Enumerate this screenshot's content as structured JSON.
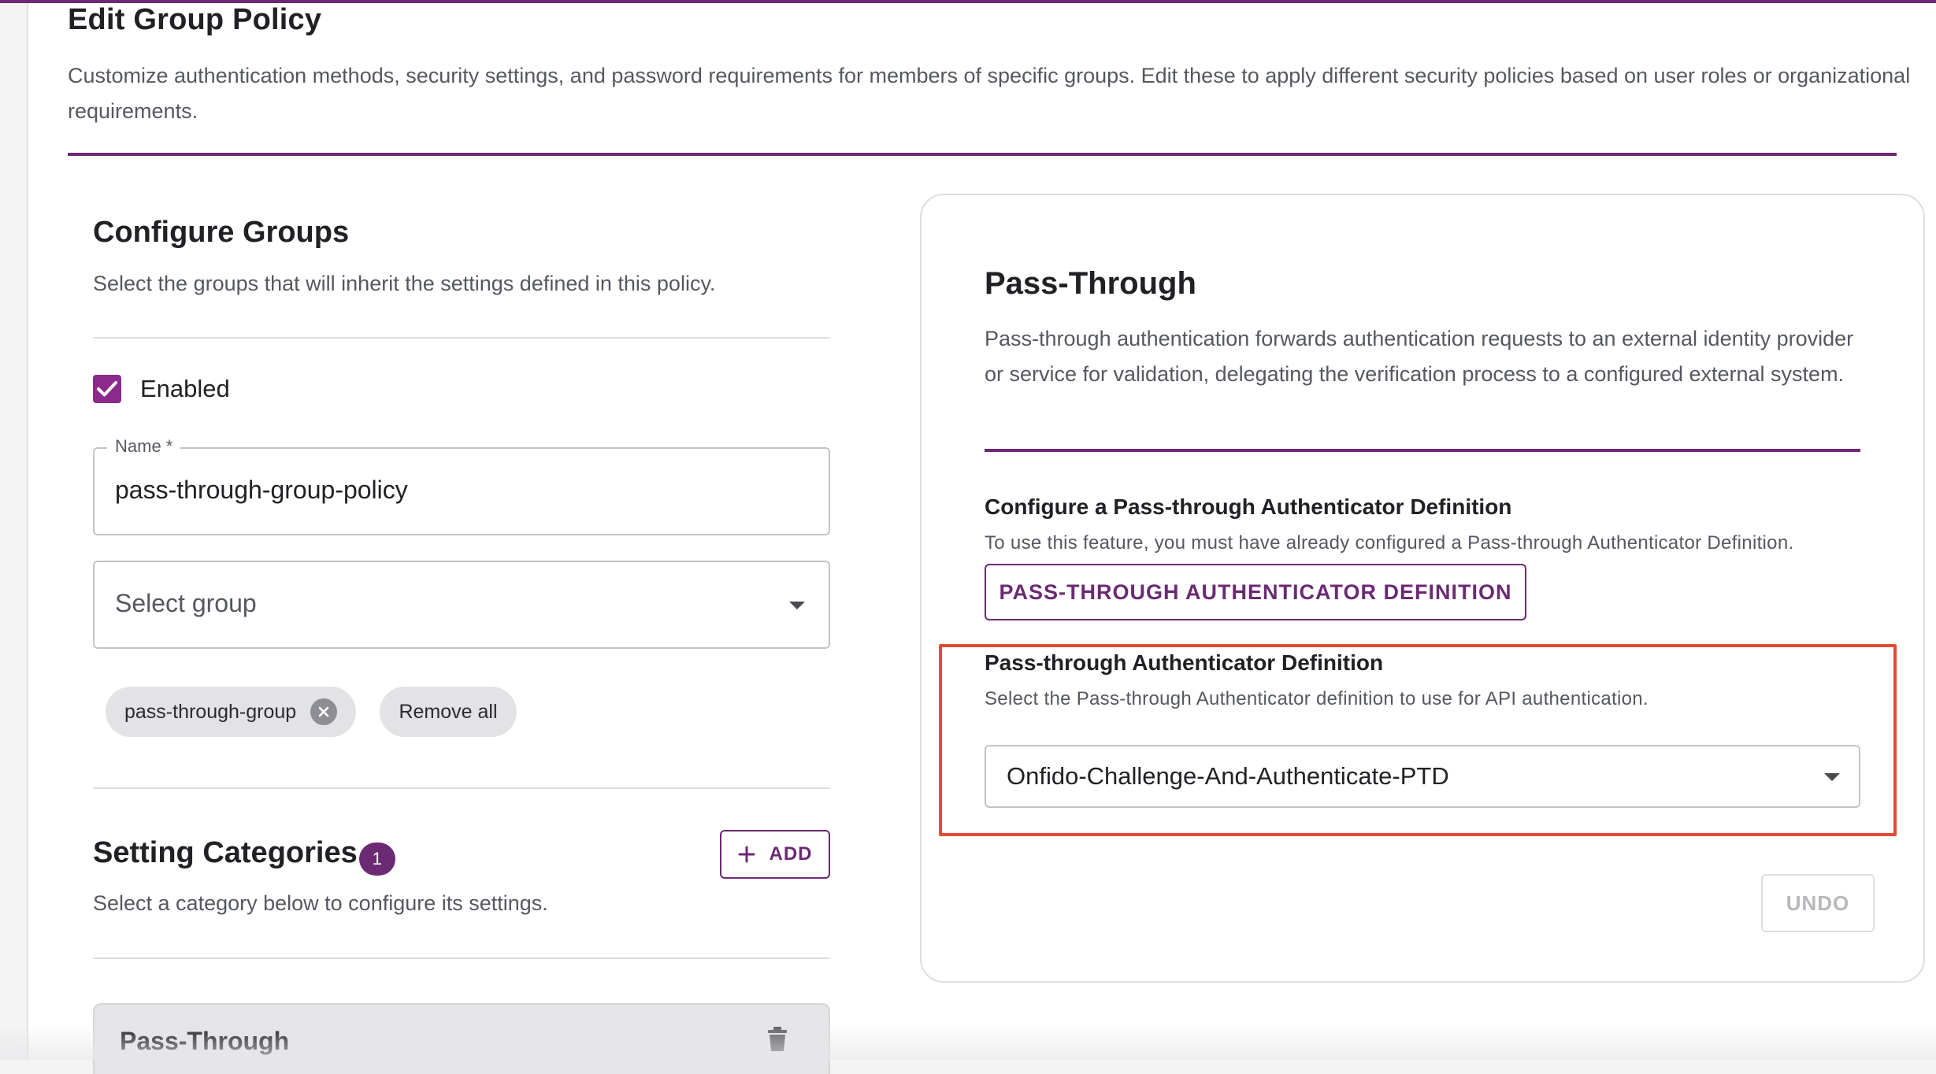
{
  "header": {
    "title": "Edit Group Policy",
    "description": "Customize authentication methods, security settings, and password requirements for members of specific groups. Edit these to apply different security policies based on user roles or organizational requirements."
  },
  "configure_groups": {
    "title": "Configure Groups",
    "subtitle": "Select the groups that will inherit the settings defined in this policy.",
    "enabled_label": "Enabled",
    "enabled_checked": true,
    "name_field": {
      "label": "Name *",
      "value": "pass-through-group-policy"
    },
    "group_select": {
      "placeholder": "Select group"
    },
    "chips": [
      {
        "label": "pass-through-group"
      }
    ],
    "remove_all_label": "Remove all"
  },
  "setting_categories": {
    "title": "Setting Categories",
    "count": "1",
    "subtitle": "Select a category below to configure its settings.",
    "add_label": "ADD",
    "items": [
      {
        "title": "Pass-Through"
      }
    ]
  },
  "pass_through_panel": {
    "title": "Pass-Through",
    "description": "Pass-through authentication forwards authentication requests to an external identity provider or service for validation, delegating the verification process to a configured external system.",
    "configure_heading": "Configure a Pass-through Authenticator Definition",
    "configure_note": "To use this feature, you must have already configured a Pass-through Authenticator Definition.",
    "definition_button": "PASS-THROUGH AUTHENTICATOR DEFINITION",
    "select_heading": "Pass-through Authenticator Definition",
    "select_note": "Select the Pass-through Authenticator definition to use for API authentication.",
    "selected_value": "Onfido-Challenge-And-Authenticate-PTD",
    "undo_label": "UNDO"
  },
  "colors": {
    "accent": "#6b2a73",
    "checkbox": "#8c2a8c",
    "highlight": "#e24b34"
  },
  "icons": [
    "check-icon",
    "caret-down-icon",
    "close-circle-icon",
    "plus-icon",
    "trash-icon"
  ]
}
